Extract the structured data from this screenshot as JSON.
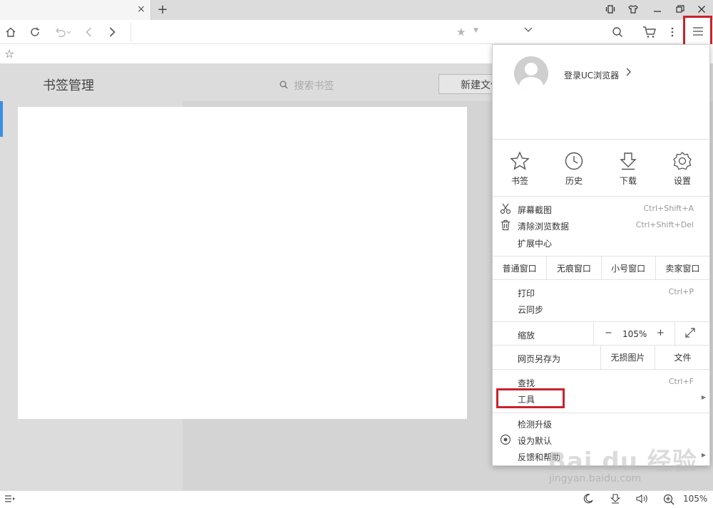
{
  "menu": {
    "login": "登录UC浏览器",
    "quick": [
      {
        "label": "书签",
        "icon": "star-icon"
      },
      {
        "label": "历史",
        "icon": "clock-icon"
      },
      {
        "label": "下载",
        "icon": "download-icon"
      },
      {
        "label": "设置",
        "icon": "gear-icon"
      }
    ],
    "screenshot": {
      "label": "屏幕截图",
      "shortcut": "Ctrl+Shift+A"
    },
    "clear_data": {
      "label": "清除浏览数据",
      "shortcut": "Ctrl+Shift+Del"
    },
    "extensions": {
      "label": "扩展中心"
    },
    "windows": [
      "普通窗口",
      "无痕窗口",
      "小号窗口",
      "卖家窗口"
    ],
    "print": {
      "label": "打印",
      "shortcut": "Ctrl+P"
    },
    "sync": {
      "label": "云同步"
    },
    "zoom": {
      "label": "缩放",
      "minus": "−",
      "value": "105%",
      "plus": "+"
    },
    "save": {
      "label": "网页另存为",
      "image": "无损图片",
      "file": "文件"
    },
    "find": {
      "label": "查找",
      "shortcut": "Ctrl+F"
    },
    "tools": {
      "label": "工具"
    },
    "upgrade": {
      "label": "检测升级"
    },
    "set_default": {
      "label": "设为默认"
    },
    "feedback": {
      "label": "反馈和帮助"
    }
  },
  "content": {
    "title": "书签管理",
    "search_placeholder": "搜索书签",
    "new_folder": "新建文件夹"
  },
  "tab": {
    "close": "×"
  },
  "new_tab": "+",
  "status": {
    "zoom": "105%"
  },
  "watermark": {
    "brand": "Bai du 经验",
    "url": "jingyan.baidu.com"
  },
  "colors": {
    "highlight": "#c8232c",
    "accent": "#3a8ee6"
  }
}
